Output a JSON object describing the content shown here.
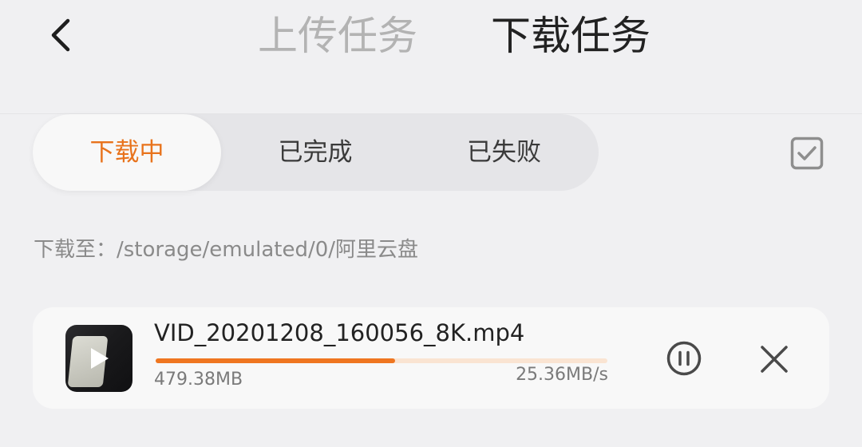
{
  "header": {
    "back_icon": "chevron-left-icon",
    "tabs": [
      {
        "label": "上传任务",
        "active": false
      },
      {
        "label": "下载任务",
        "active": true
      }
    ]
  },
  "segments": {
    "items": [
      {
        "label": "下载中",
        "active": true
      },
      {
        "label": "已完成",
        "active": false
      },
      {
        "label": "已失败",
        "active": false
      }
    ],
    "select_icon": "checkbox-icon"
  },
  "download_path": "下载至：/storage/emulated/0/阿里云盘",
  "tasks": [
    {
      "file_name": "VID_20201208_160056_8K.mp4",
      "size": "479.38MB",
      "speed": "25.36MB/s",
      "progress": 0.53,
      "thumbnail_icon": "video-play-icon",
      "pause_icon": "pause-circle-icon",
      "cancel_icon": "close-icon"
    }
  ],
  "colors": {
    "accent": "#ef7620",
    "active_tab_text": "#e8731c",
    "progress_track": "#fae4d2",
    "background": "#f0f0f2",
    "card": "#f8f8f8"
  }
}
